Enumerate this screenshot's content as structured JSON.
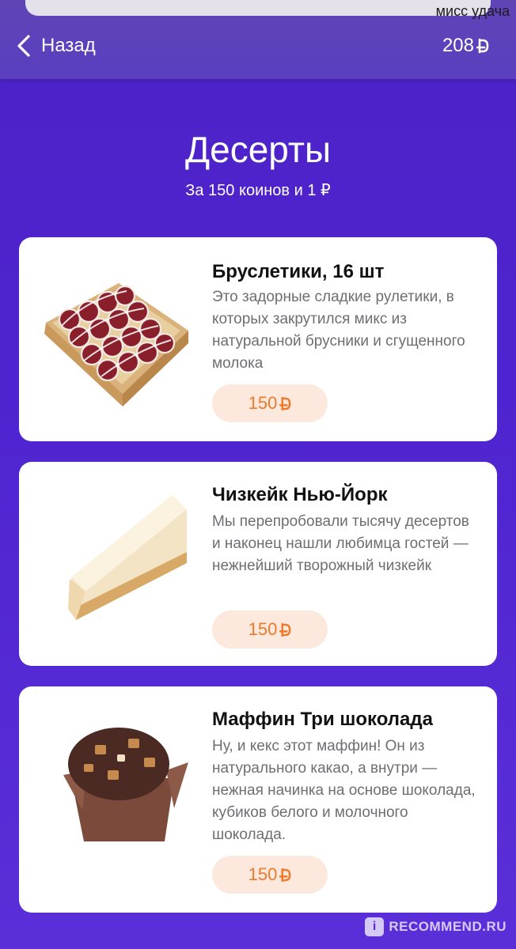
{
  "watermark": {
    "user": "мисс удача",
    "site": "RECOMMEND.RU",
    "logo_letter": "i"
  },
  "header": {
    "back_label": "Назад",
    "balance": "208",
    "coin_icon": "coin-icon"
  },
  "page": {
    "title": "Десерты",
    "subtitle": "За 150 коинов и 1 ₽"
  },
  "products": [
    {
      "name": "Бруслетики, 16 шт",
      "description": "Это задорные сладкие рулетики, в которых закрутился микс из натуральной брусники и сгущенного молока",
      "price": "150"
    },
    {
      "name": "Чизкейк Нью-Йорк",
      "description": "Мы перепробовали тысячу десертов и наконец нашли любимца гостей — нежнейший творожный чизкейк",
      "price": "150"
    },
    {
      "name": "Маффин Три шоколада",
      "description": "Ну, и кекс этот маффин! Он из натурального какао, а внутри — нежная начинка на основе шоколада, кубиков белого и молочного шоколада.",
      "price": "150"
    }
  ],
  "colors": {
    "background": "#4e24d0",
    "price_bg": "#fce8dc",
    "price_text": "#f07a2a"
  }
}
